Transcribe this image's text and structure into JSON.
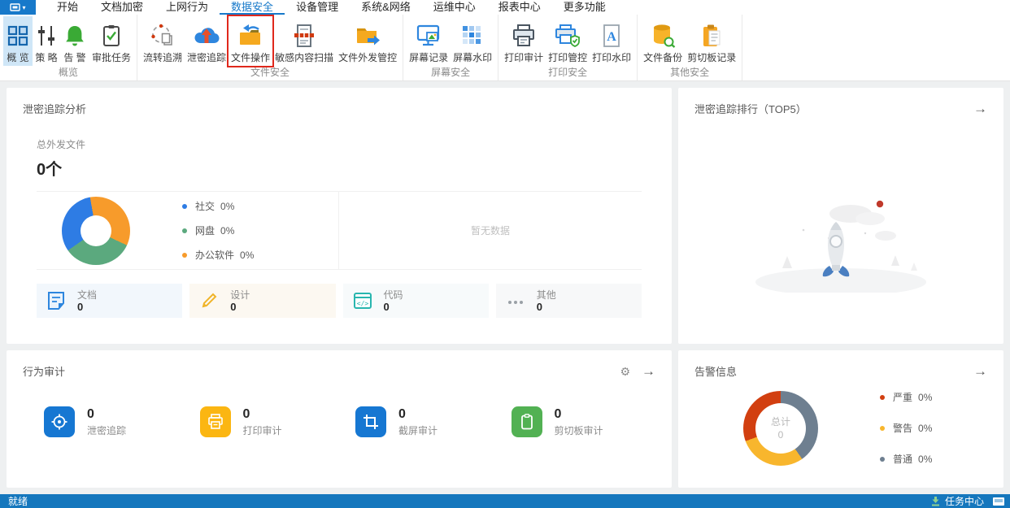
{
  "app": {
    "tabs": [
      "开始",
      "文档加密",
      "上网行为",
      "数据安全",
      "设备管理",
      "系统&网络",
      "运维中心",
      "报表中心",
      "更多功能"
    ],
    "active_tab": "数据安全"
  },
  "ribbon": {
    "groups": [
      {
        "label": "概览",
        "items": [
          {
            "label": "概 览",
            "icon": "overview-grid-icon",
            "selected": true
          },
          {
            "label": "策 略",
            "icon": "policy-sliders-icon"
          },
          {
            "label": "告 警",
            "icon": "alert-bell-icon"
          },
          {
            "label": "审批任务",
            "icon": "approval-tasks-icon"
          }
        ]
      },
      {
        "label": "文件安全",
        "items": [
          {
            "label": "流转追溯",
            "icon": "flow-trace-icon"
          },
          {
            "label": "泄密追踪",
            "icon": "leak-trace-icon"
          },
          {
            "label": "文件操作",
            "icon": "file-operation-icon",
            "highlighted": true
          },
          {
            "label": "敏感内容扫描",
            "icon": "sensitive-scan-icon"
          },
          {
            "label": "文件外发管控",
            "icon": "file-outgoing-icon"
          }
        ]
      },
      {
        "label": "屏幕安全",
        "items": [
          {
            "label": "屏幕记录",
            "icon": "screen-record-icon"
          },
          {
            "label": "屏幕水印",
            "icon": "screen-watermark-icon"
          }
        ]
      },
      {
        "label": "打印安全",
        "items": [
          {
            "label": "打印审计",
            "icon": "print-audit-icon"
          },
          {
            "label": "打印管控",
            "icon": "print-control-icon"
          },
          {
            "label": "打印水印",
            "icon": "print-watermark-icon"
          }
        ]
      },
      {
        "label": "其他安全",
        "items": [
          {
            "label": "文件备份",
            "icon": "file-backup-icon"
          },
          {
            "label": "剪切板记录",
            "icon": "clipboard-record-icon"
          }
        ]
      }
    ]
  },
  "leak_panel": {
    "title": "泄密追踪分析",
    "total_label": "总外发文件",
    "total_value": "0个",
    "empty_text": "暂无数据",
    "legend": [
      {
        "label": "社交",
        "value": "0%"
      },
      {
        "label": "网盘",
        "value": "0%"
      },
      {
        "label": "办公软件",
        "value": "0%"
      }
    ],
    "cards": [
      {
        "label": "文档",
        "value": "0"
      },
      {
        "label": "设计",
        "value": "0"
      },
      {
        "label": "代码",
        "value": "0"
      },
      {
        "label": "其他",
        "value": "0"
      }
    ]
  },
  "rank_panel": {
    "title": "泄密追踪排行（TOP5）"
  },
  "behavior_panel": {
    "title": "行为审计",
    "items": [
      {
        "value": "0",
        "label": "泄密追踪"
      },
      {
        "value": "0",
        "label": "打印审计"
      },
      {
        "value": "0",
        "label": "截屏审计"
      },
      {
        "value": "0",
        "label": "剪切板审计"
      }
    ]
  },
  "alert_panel": {
    "title": "告警信息",
    "center_label": "总计",
    "center_value": "0",
    "legend": [
      {
        "label": "严重",
        "value": "0%"
      },
      {
        "label": "警告",
        "value": "0%"
      },
      {
        "label": "普通",
        "value": "0%"
      }
    ]
  },
  "statusbar": {
    "left": "就绪",
    "right": "任务中心"
  },
  "chart_data": [
    {
      "type": "pie",
      "title": "泄密追踪分析 外发渠道占比",
      "categories": [
        "社交",
        "网盘",
        "办公软件"
      ],
      "values": [
        0,
        0,
        0
      ],
      "display_percent": [
        "0%",
        "0%",
        "0%"
      ],
      "colors": [
        "#2e7ce4",
        "#5ba97e",
        "#f79b2b"
      ],
      "legend_position": "right",
      "note": "暂无数据（placeholder donut drawn as equal thirds）",
      "donut": {
        "start_deg": -10,
        "segments": [
          {
            "color": "#f79b2b",
            "span": 125
          },
          {
            "color": "#5ba97e",
            "span": 120
          },
          {
            "color": "#2e7ce4",
            "span": 115
          }
        ]
      }
    },
    {
      "type": "pie",
      "title": "告警信息",
      "categories": [
        "严重",
        "警告",
        "普通"
      ],
      "values": [
        0,
        0,
        0
      ],
      "display_percent": [
        "0%",
        "0%",
        "0%"
      ],
      "colors": [
        "#d23f10",
        "#f8b62d",
        "#6e7f90"
      ],
      "center_label": "总计",
      "center_value": "0",
      "legend_position": "right",
      "donut": {
        "start_deg": 0,
        "segments": [
          {
            "color": "#6e7f90",
            "span": 145
          },
          {
            "color": "#f8b62d",
            "span": 105
          },
          {
            "color": "#d23f10",
            "span": 110
          }
        ]
      }
    }
  ]
}
